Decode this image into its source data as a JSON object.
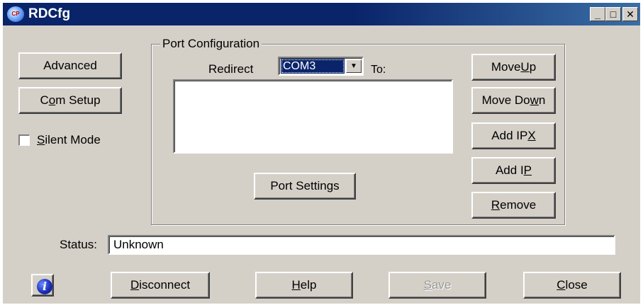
{
  "window": {
    "title": "RDCfg",
    "minimize": "_",
    "maximize": "□",
    "close": "✕",
    "app_icon_text": "CP"
  },
  "left": {
    "advanced": "Advanced",
    "com_setup": {
      "pre": "C",
      "ul": "o",
      "post": "m Setup"
    },
    "silent_mode": {
      "ul": "S",
      "post": "ilent Mode",
      "checked": false
    }
  },
  "port_config": {
    "title": "Port Configuration",
    "redirect_label": "Redirect",
    "redirect_value": "COM3",
    "to_label": "To:",
    "port_settings": "Port Settings",
    "move_up": {
      "pre": "Move ",
      "ul": "U",
      "post": "p"
    },
    "move_down": {
      "pre": "Move Do",
      "ul": "w",
      "post": "n"
    },
    "add_ipx": {
      "pre": "Add IP",
      "ul": "X",
      "post": ""
    },
    "add_ip": {
      "pre": "Add I",
      "ul": "P",
      "post": ""
    },
    "remove": {
      "pre": "",
      "ul": "R",
      "post": "emove"
    }
  },
  "status": {
    "label": "Status:",
    "value": "Unknown"
  },
  "footer": {
    "info_icon": "i",
    "disconnect": {
      "pre": "",
      "ul": "D",
      "post": "isconnect"
    },
    "help": {
      "pre": "",
      "ul": "H",
      "post": "elp"
    },
    "save": {
      "pre": "",
      "ul": "S",
      "post": "ave",
      "disabled": true
    },
    "close": {
      "pre": "",
      "ul": "C",
      "post": "lose"
    }
  },
  "colors": {
    "title_bar": "#0a246a",
    "face": "#d4d0c8",
    "selection": "#0a246a"
  }
}
